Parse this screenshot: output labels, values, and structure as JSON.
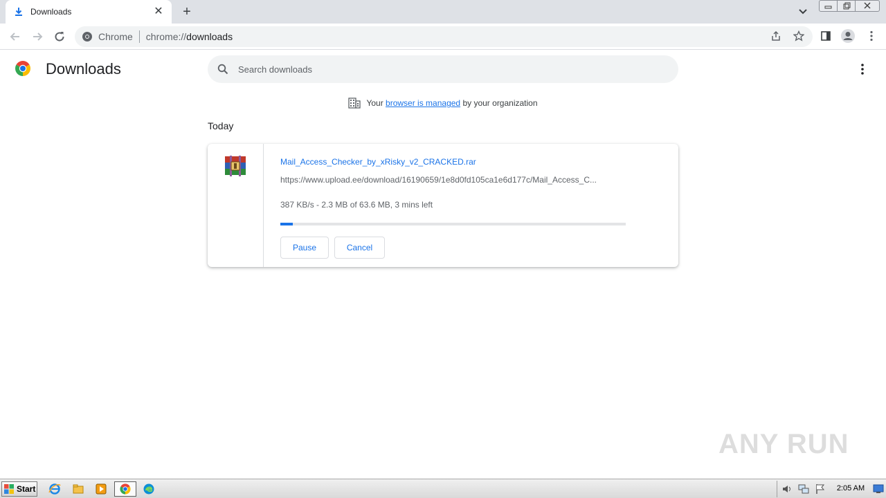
{
  "tab": {
    "title": "Downloads",
    "close_glyph": "✕"
  },
  "newtab_glyph": "+",
  "omnibox": {
    "site_label": "Chrome",
    "url_scheme": "chrome://",
    "url_path": "downloads"
  },
  "page": {
    "title": "Downloads",
    "search_placeholder": "Search downloads",
    "managed": {
      "prefix": "Your",
      "link": "browser is managed",
      "suffix": "by your organization"
    },
    "section": "Today"
  },
  "download": {
    "file_name": "Mail_Access_Checker_by_xRisky_v2_CRACKED.rar",
    "url": "https://www.upload.ee/download/16190659/1e8d0fd105ca1e6d177c/Mail_Access_C...",
    "status": "387 KB/s - 2.3 MB of 63.6 MB, 3 mins left",
    "progress_fraction": 0.036,
    "pause_label": "Pause",
    "cancel_label": "Cancel"
  },
  "watermark": "ANY RUN",
  "taskbar": {
    "start_label": "Start",
    "clock": "2:05 AM"
  },
  "colors": {
    "accent": "#1a73e8",
    "tabstrip": "#dee1e6",
    "omnibox": "#f1f3f4"
  }
}
